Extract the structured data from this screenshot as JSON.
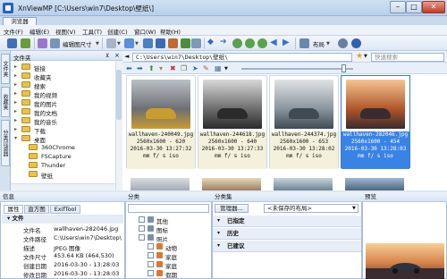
{
  "window": {
    "title": "XnViewMP [C:\\Users\\win7\\Desktop\\壁纸\\]",
    "minimize": "–",
    "maximize": "□",
    "close": "✕"
  },
  "tabs": {
    "browser": "浏览器"
  },
  "menu": [
    "文件(F)",
    "编辑(E)",
    "视图(V)",
    "工具(T)",
    "创建(C)",
    "窗口(W)",
    "帮助(H)"
  ],
  "toolbar": {
    "resize_label": "编辑图尺寸",
    "layout_label": "布局"
  },
  "folders_panel": {
    "title": "文件夹",
    "tree": [
      {
        "label": "链接",
        "icon": "folder"
      },
      {
        "label": "收藏夹",
        "icon": "folder"
      },
      {
        "label": "搜索",
        "icon": "folder"
      },
      {
        "label": "我的视频",
        "icon": "folder"
      },
      {
        "label": "我的图片",
        "icon": "folder"
      },
      {
        "label": "我的文档",
        "icon": "folder"
      },
      {
        "label": "我的音乐",
        "icon": "folder"
      },
      {
        "label": "下载",
        "icon": "folder"
      },
      {
        "label": "桌面",
        "icon": "folder",
        "expanded": true
      },
      {
        "label": "360Chrome",
        "icon": "folder",
        "indent": 1
      },
      {
        "label": "FSCapture",
        "icon": "folder",
        "indent": 1
      },
      {
        "label": "Thunder",
        "icon": "folder",
        "indent": 1
      },
      {
        "label": "壁纸",
        "icon": "folder",
        "indent": 1
      }
    ],
    "side_tabs": [
      "文件夹",
      "收藏夹",
      "分类过滤器"
    ]
  },
  "address": {
    "path": "C:\\Users\\win7\\Desktop\\壁纸\\",
    "search_placeholder": "快速搜索"
  },
  "thumbnails": [
    {
      "name": "wallhaven-240049.jpg",
      "size": "2560x1600 - 620",
      "date": "2016-03-30 13:27:32",
      "exif": "mm f/ s iso",
      "photo_colors": [
        "#b9c0c6",
        "#6d6f73",
        "#c99c2e"
      ],
      "selected": false
    },
    {
      "name": "wallhaven-244618.jpg",
      "size": "2560x1600 - 640",
      "date": "2016-03-30 13:27:33",
      "exif": "mm f/ s iso",
      "photo_colors": [
        "#d8d8d8",
        "#6c6c6c",
        "#2b2b2b"
      ],
      "selected": false
    },
    {
      "name": "wallhaven-244374.jpg",
      "size": "2560x1600 - 653",
      "date": "2016-03-30 13:28:02",
      "exif": "mm f/ s iso",
      "photo_colors": [
        "#dfe3e6",
        "#8a949c",
        "#3f4a52"
      ],
      "selected": false
    },
    {
      "name": "wallhaven-282046.jpg",
      "size": "2560x1600 - 454",
      "date": "2016-03-30 13:28:03",
      "exif": "mm f/ s iso",
      "photo_colors": [
        "#f4c590",
        "#b0552a",
        "#3a2b2e"
      ],
      "selected": true
    }
  ],
  "info_panel": {
    "title": "信息",
    "tabs": [
      "属性",
      "直方图",
      "ExifTool"
    ],
    "section": "文件",
    "rows": [
      {
        "key": "文件名",
        "value": "wallhaven-282046.jpg"
      },
      {
        "key": "文件路径",
        "value": "C:\\Users\\win7\\Desktop\\"
      },
      {
        "key": "描述",
        "value": "JPEG 图像"
      },
      {
        "key": "文件尺寸",
        "value": "453.64 KB (464,530)"
      },
      {
        "key": "创建日期",
        "value": "2016-03-30 - 13:28:03"
      },
      {
        "key": "修改日期",
        "value": "2016-03-30 - 13:28:03"
      }
    ]
  },
  "category_panel": {
    "title": "分类",
    "items": [
      {
        "label": "其他",
        "indent": 0
      },
      {
        "label": "图标",
        "indent": 0
      },
      {
        "label": "照片",
        "indent": 0
      },
      {
        "label": "动物",
        "indent": 1
      },
      {
        "label": "家庭",
        "indent": 1
      },
      {
        "label": "家庭",
        "indent": 1
      },
      {
        "label": "假期",
        "indent": 1
      }
    ]
  },
  "category_set_panel": {
    "title": "分类集",
    "manage_button": "管理器...",
    "preset": "<未保存的布局>",
    "rows": [
      "已指定",
      "历史",
      "已建议"
    ]
  },
  "preview_panel": {
    "title": "预览"
  }
}
